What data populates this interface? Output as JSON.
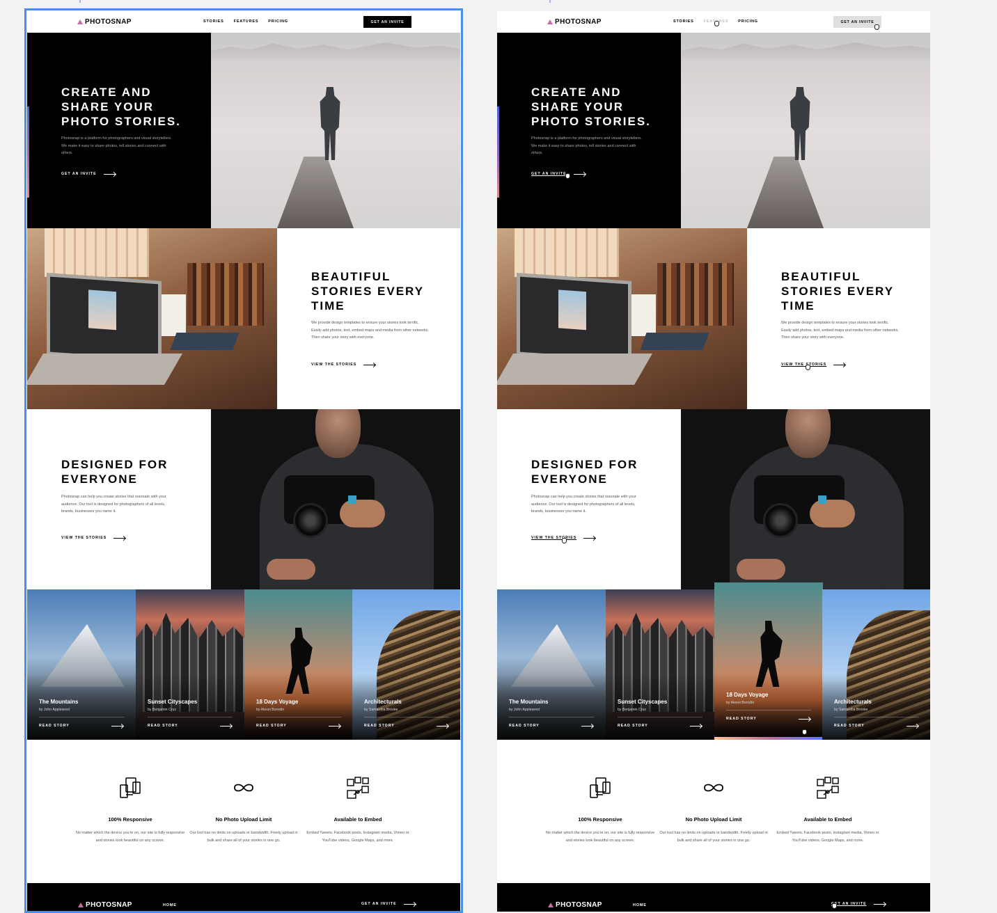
{
  "nav": {
    "logo": "PHOTOSNAP",
    "links": [
      "STORIES",
      "FEATURES",
      "PRICING"
    ],
    "cta": "GET AN INVITE"
  },
  "hero": {
    "title": "CREATE AND SHARE YOUR PHOTO STORIES.",
    "description": "Photosnap is a platform for photographers and visual storytellers. We make it easy to share photos, tell stories and connect with others.",
    "cta": "GET AN INVITE"
  },
  "section2": {
    "title": "BEAUTIFUL STORIES EVERY TIME",
    "description": "We provide design templates to ensure your stories look terrific. Easily add photos, text, embed maps and media from other networks. Then share your story with everyone.",
    "cta": "VIEW THE STORIES"
  },
  "section3": {
    "title": "DESIGNED FOR EVERYONE",
    "description": "Photosnap can help you create stories that resonate with your audience. Our tool is designed for photographers of all levels, brands, businesses you name it.",
    "cta": "VIEW THE STORIES"
  },
  "stories": [
    {
      "title": "The Mountains",
      "author": "by John Appleseed",
      "cta": "READ STORY"
    },
    {
      "title": "Sunset Cityscapes",
      "author": "by Benjamin Cruz",
      "cta": "READ STORY"
    },
    {
      "title": "18 Days Voyage",
      "author": "by Alexei Borodin",
      "cta": "READ STORY"
    },
    {
      "title": "Architecturals",
      "author": "by Samantha Brooke",
      "cta": "READ STORY"
    }
  ],
  "features": [
    {
      "icon": "responsive-devices-icon",
      "title": "100% Responsive",
      "description": "No matter which the device you're on, our site is fully responsive and stories look beautiful on any screen."
    },
    {
      "icon": "infinity-icon",
      "title": "No Photo Upload Limit",
      "description": "Our tool has no limits on uploads or bandwidth. Freely upload in bulk and share all of your stories in one go."
    },
    {
      "icon": "embed-icon",
      "title": "Available to Embed",
      "description": "Embed Tweets, Facebook posts, Instagram media, Vimeo or YouTube videos, Google Maps, and more."
    }
  ],
  "footer": {
    "logo": "PHOTOSNAP",
    "link": "HOME",
    "cta": "GET AN INVITE"
  },
  "colors": {
    "selection_outline": "#4a90e2",
    "accent_gradient": [
      "#ffc593",
      "#bc7198",
      "#5a77ff"
    ]
  }
}
